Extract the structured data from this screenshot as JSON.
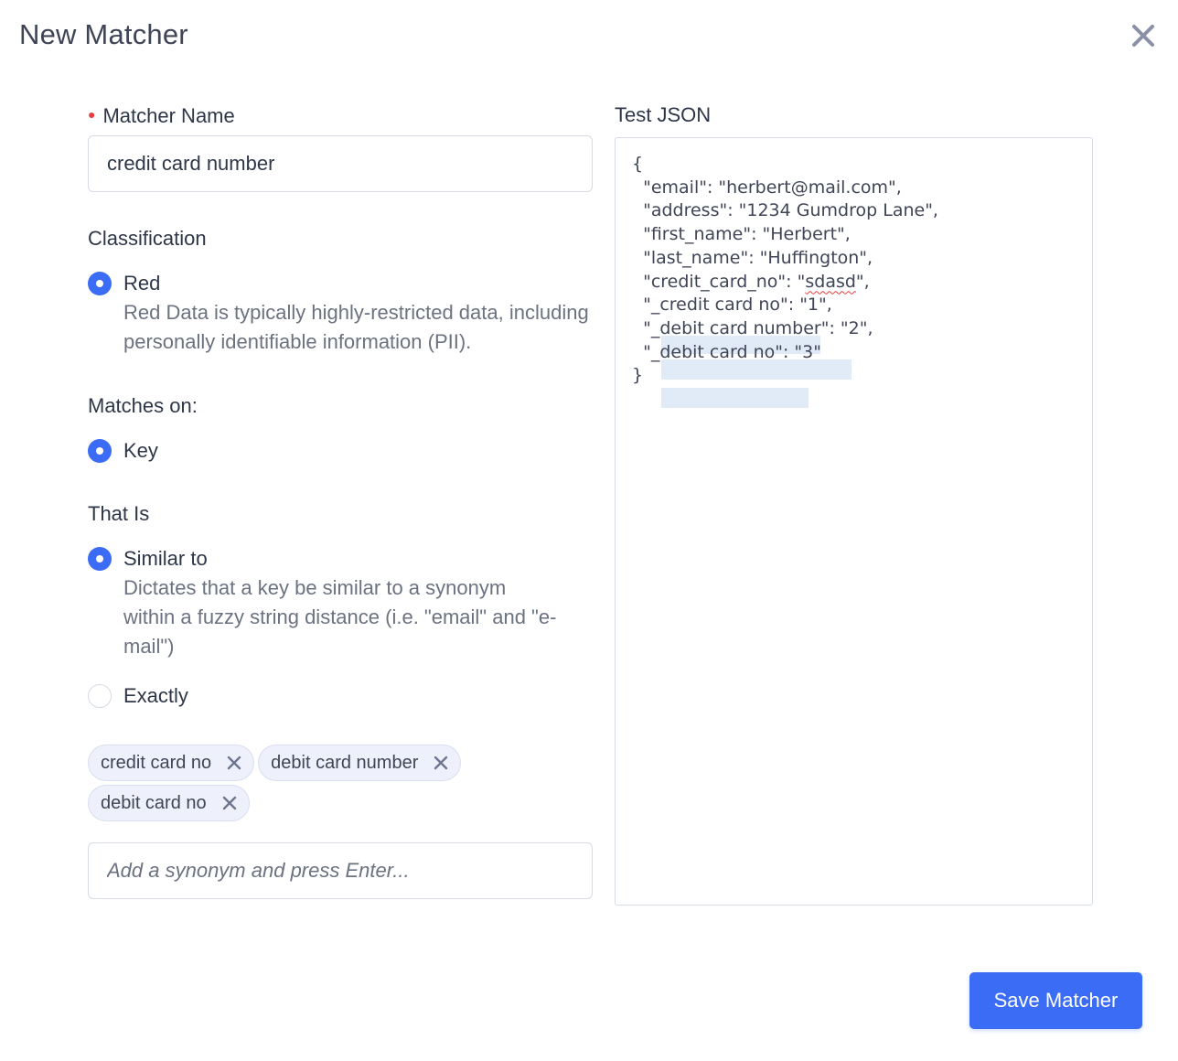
{
  "modal": {
    "title": "New Matcher",
    "close_icon": "close-icon"
  },
  "form": {
    "name_label": "Matcher Name",
    "name_value": "credit card number",
    "classification_title": "Classification",
    "classification_options": [
      {
        "label": "Red",
        "description": "Red Data is typically highly-restricted data, including personally identifiable information (PII).",
        "checked": true
      }
    ],
    "matches_on_title": "Matches on:",
    "matches_on_options": [
      {
        "label": "Key",
        "checked": true
      }
    ],
    "that_is_title": "That Is",
    "that_is_options": [
      {
        "label": "Similar to",
        "description": "Dictates that a key be similar to a synonym within a fuzzy string distance (i.e. \"email\" and \"e-mail\")",
        "checked": true
      },
      {
        "label": "Exactly",
        "checked": false
      }
    ],
    "synonyms": [
      "credit card no",
      "debit card number",
      "debit card no"
    ],
    "synonym_placeholder": "Add a synonym and press Enter..."
  },
  "test_json": {
    "label": "Test JSON",
    "open_brace": "{",
    "lines": [
      {
        "pre": "  \"email\": \"herbert@mail.com\",",
        "err": "",
        "post": ""
      },
      {
        "pre": "  \"address\": \"1234 Gumdrop Lane\",",
        "err": "",
        "post": ""
      },
      {
        "pre": "  \"first_name\": \"Herbert\",",
        "err": "",
        "post": ""
      },
      {
        "pre": "  \"last_name\": \"Huffington\",",
        "err": "",
        "post": ""
      },
      {
        "pre": "  \"credit_card_no\": \"",
        "err": "sdasd",
        "post": "\","
      },
      {
        "pre": "  \"_credit card no\": \"1\",",
        "err": "",
        "post": ""
      },
      {
        "pre": "  \"_debit card number\": \"2\",",
        "err": "",
        "post": ""
      },
      {
        "pre": "  \"_debit card no\": \"3\"",
        "err": "",
        "post": ""
      }
    ],
    "close_brace": "}"
  },
  "actions": {
    "save_label": "Save Matcher"
  },
  "colors": {
    "primary": "#3b6cf5",
    "required": "#e53e3e",
    "chip_bg": "#eef1fb"
  }
}
